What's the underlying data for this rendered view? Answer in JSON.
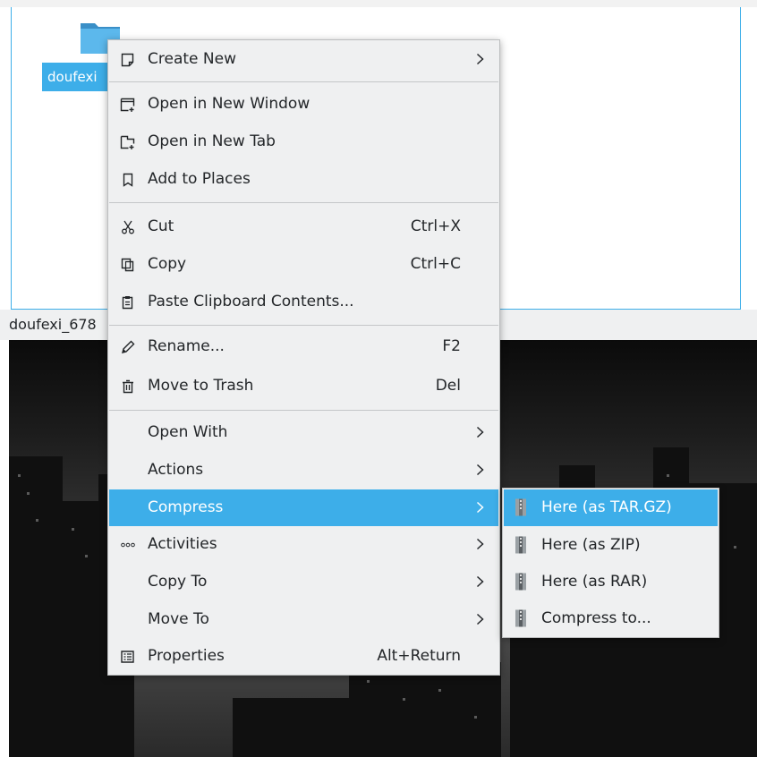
{
  "file_manager": {
    "selected_item_label": "doufexi",
    "status_text": "doufexi_678"
  },
  "context_menu": {
    "items": [
      {
        "label": "Create New",
        "icon": "new-document-icon",
        "shortcut": "",
        "submenu": true
      },
      {
        "label": "Open in New Window",
        "icon": "new-window-icon",
        "shortcut": "",
        "submenu": false
      },
      {
        "label": "Open in New Tab",
        "icon": "new-tab-icon",
        "shortcut": "",
        "submenu": false
      },
      {
        "label": "Add to Places",
        "icon": "bookmark-icon",
        "shortcut": "",
        "submenu": false
      },
      {
        "label": "Cut",
        "icon": "scissors-icon",
        "shortcut": "Ctrl+X",
        "submenu": false
      },
      {
        "label": "Copy",
        "icon": "copy-icon",
        "shortcut": "Ctrl+C",
        "submenu": false
      },
      {
        "label": "Paste Clipboard Contents...",
        "icon": "paste-icon",
        "shortcut": "",
        "submenu": false
      },
      {
        "label": "Rename...",
        "icon": "pencil-icon",
        "shortcut": "F2",
        "submenu": false
      },
      {
        "label": "Move to Trash",
        "icon": "trash-icon",
        "shortcut": "Del",
        "submenu": false
      },
      {
        "label": "Open With",
        "icon": "",
        "shortcut": "",
        "submenu": true
      },
      {
        "label": "Actions",
        "icon": "",
        "shortcut": "",
        "submenu": true
      },
      {
        "label": "Compress",
        "icon": "",
        "shortcut": "",
        "submenu": true,
        "highlighted": true
      },
      {
        "label": "Activities",
        "icon": "activities-icon",
        "shortcut": "",
        "submenu": true
      },
      {
        "label": "Copy To",
        "icon": "",
        "shortcut": "",
        "submenu": true
      },
      {
        "label": "Move To",
        "icon": "",
        "shortcut": "",
        "submenu": true
      },
      {
        "label": "Properties",
        "icon": "properties-icon",
        "shortcut": "Alt+Return",
        "submenu": false
      }
    ]
  },
  "compress_submenu": {
    "items": [
      {
        "label": "Here (as TAR.GZ)",
        "icon": "archive-icon",
        "highlighted": true
      },
      {
        "label": "Here (as ZIP)",
        "icon": "archive-icon"
      },
      {
        "label": "Here (as RAR)",
        "icon": "archive-icon"
      },
      {
        "label": "Compress to...",
        "icon": "archive-icon"
      }
    ]
  },
  "colors": {
    "accent": "#3daee9",
    "menu_background": "#eff0f1",
    "text": "#232629"
  }
}
